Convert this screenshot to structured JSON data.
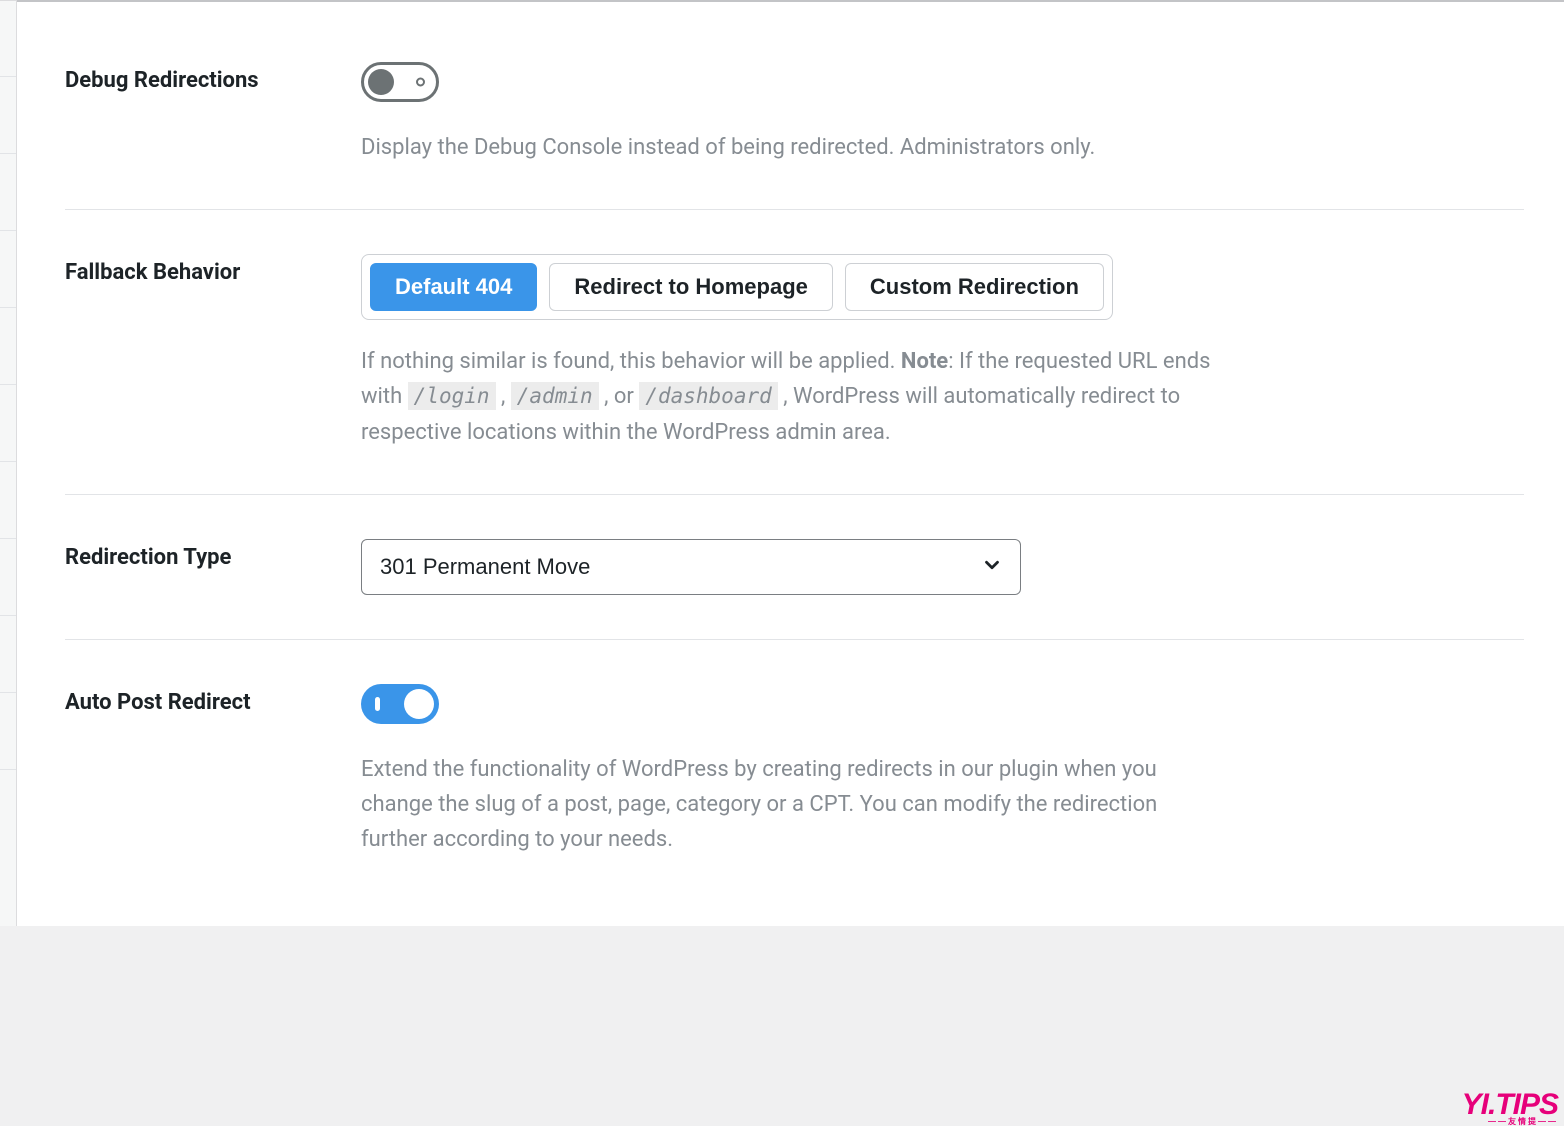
{
  "settings": {
    "debug_redirections": {
      "label": "Debug Redirections",
      "state": "off",
      "description": "Display the Debug Console instead of being redirected. Administrators only."
    },
    "fallback_behavior": {
      "label": "Fallback Behavior",
      "options": [
        {
          "label": "Default 404",
          "active": true
        },
        {
          "label": "Redirect to Homepage",
          "active": false
        },
        {
          "label": "Custom Redirection",
          "active": false
        }
      ],
      "description_pre": "If nothing similar is found, this behavior will be applied. ",
      "note_label": "Note",
      "description_mid1": ": If the requested URL ends with ",
      "code1": "/login",
      "sep1": " , ",
      "code2": "/admin",
      "sep2": " , or ",
      "code3": "/dashboard",
      "description_post": " , WordPress will automatically redirect to respective locations within the WordPress admin area."
    },
    "redirection_type": {
      "label": "Redirection Type",
      "selected": "301 Permanent Move"
    },
    "auto_post_redirect": {
      "label": "Auto Post Redirect",
      "state": "on",
      "description": "Extend the functionality of WordPress by creating redirects in our plugin when you change the slug of a post, page, category or a CPT. You can modify the redirection further according to your needs."
    }
  },
  "watermark": {
    "text": "YI.TIPS",
    "sub": "——友情提——"
  }
}
